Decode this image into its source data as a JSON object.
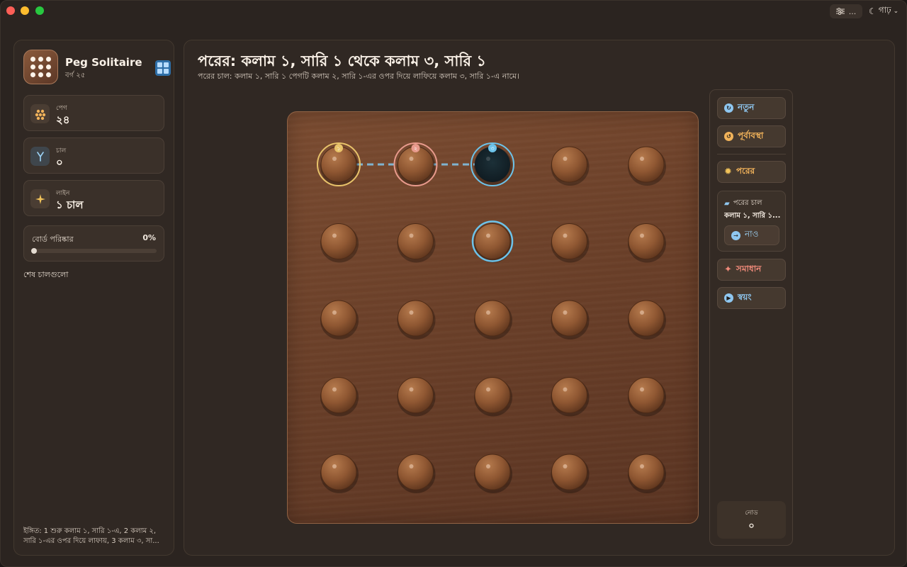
{
  "window": {
    "toolbar_more": "...",
    "theme_label": "গাঢ়"
  },
  "sidebar": {
    "app_name": "Peg Solitaire",
    "board_variant": "বর্গ ২৫",
    "stats": [
      {
        "label": "পেগ",
        "value": "২৪",
        "icon": "pegs-icon"
      },
      {
        "label": "চাল",
        "value": "০",
        "icon": "fork-icon"
      },
      {
        "label": "লাইন",
        "value": "১ চাল",
        "icon": "sparkle-icon"
      }
    ],
    "progress": {
      "label": "বোর্ড পরিষ্কার",
      "percent_text": "0%",
      "fraction": 0.0
    },
    "last_moves_title": "শেষ চালগুলো",
    "hint": "ইঙ্গিত: 1 শুরু কলাম ১, সারি ১-এ, 2 কলাম ২, সারি ১-এর ওপর দিয়ে লাফায়, 3 কলাম ৩, সা..."
  },
  "main": {
    "title": "পরের: কলাম ১, সারি ১ থেকে কলাম ৩, সারি ১",
    "subtitle": "পরের চাল: কলাম ১, সারি ১ পেগটি কলাম ২, সারি ১-এর ওপর দিয়ে লাফিয়ে কলাম ৩, সারি ১-এ নামে।"
  },
  "board": {
    "rows": 5,
    "cols": 5,
    "empty_cells": [
      [
        0,
        2
      ]
    ],
    "move_path": {
      "from": [
        0,
        0
      ],
      "over": [
        0,
        1
      ],
      "to": [
        0,
        2
      ],
      "badges": [
        "১",
        "২",
        "৩"
      ],
      "colors": {
        "from": "#e8c36a",
        "over": "#e89a8c",
        "to": "#6cc3ea"
      }
    },
    "highlighted_peg": [
      1,
      2
    ],
    "colors": {
      "peg": "#9a5e36",
      "peg_dark": "#5e351d",
      "highlight": "#6cc3ea"
    }
  },
  "actions": {
    "new_label": "নতুন",
    "undo_label": "পূর্বাবস্থা",
    "next_label": "পরের",
    "next_move_title": "পরের চাল",
    "next_move_text": "কলাম ১, সারি ১...",
    "take_label": "নাও",
    "solve_label": "সমাধান",
    "auto_label": "স্বয়ং",
    "nodes_label": "নোড",
    "nodes_value": "০",
    "colors": {
      "new": "#8fc7f0",
      "undo": "#f2b35a",
      "next": "#f2b35a",
      "solve": "#f08a7a",
      "auto": "#8fc7f0"
    }
  }
}
